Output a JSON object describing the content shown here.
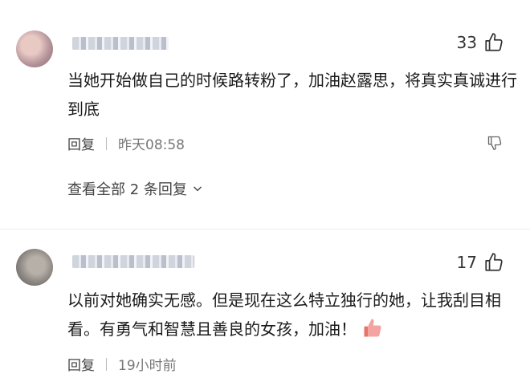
{
  "comments": [
    {
      "likes": "33",
      "text": "当她开始做自己的时候路转粉了，加油赵露思，将真实真诚进行到底",
      "reply_label": "回复",
      "time": "昨天08:58",
      "view_replies": "查看全部 2 条回复"
    },
    {
      "likes": "17",
      "text": "以前对她确实无感。但是现在这么特立独行的她，让我刮目相看。有勇气和智慧且善良的女孩，加油！",
      "emoji": "thumbs-up-emoji",
      "reply_label": "回复",
      "time": "19小时前"
    }
  ],
  "icons": {
    "like": "thumbs-up-icon",
    "dislike": "thumbs-down-icon",
    "expand": "chevron-down-icon"
  },
  "colors": {
    "text": "#1b1b1b",
    "meta": "#777777",
    "emoji": "#e8736b"
  }
}
